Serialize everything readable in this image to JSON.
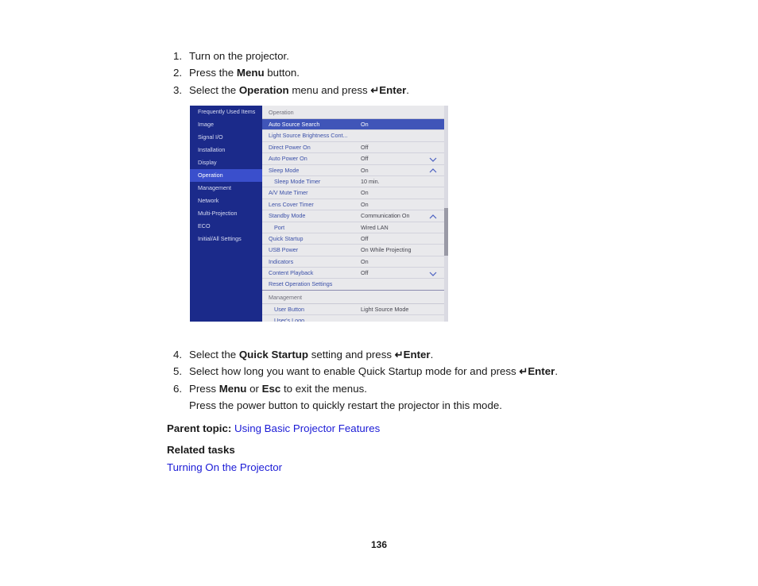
{
  "document": {
    "page_number": "136"
  },
  "steps": [
    {
      "num": "1.",
      "pre": "Turn on the projector.",
      "bold": "",
      "post": "",
      "enter": false,
      "tail": ""
    },
    {
      "num": "2.",
      "pre": "Press the ",
      "bold": "Menu",
      "post": " button.",
      "enter": false,
      "tail": ""
    },
    {
      "num": "3.",
      "pre": "Select the ",
      "bold": "Operation",
      "post": " menu and press ",
      "enter": true,
      "enter_label": "Enter",
      "tail": "."
    },
    {
      "num": "4.",
      "pre": "Select the ",
      "bold": "Quick Startup",
      "post": " setting and press ",
      "enter": true,
      "enter_label": "Enter",
      "tail": "."
    },
    {
      "num": "5.",
      "pre": "Select how long you want to enable Quick Startup mode for and press ",
      "bold": "",
      "post": "",
      "enter": true,
      "enter_label": "Enter",
      "tail": "."
    },
    {
      "num": "6.",
      "pre": "Press ",
      "bold": "Menu",
      "post": " or ",
      "bold2": "Esc",
      "post2": " to exit the menus.",
      "enter": false,
      "tail": ""
    }
  ],
  "step_labels": {
    "s1_num": "1.",
    "s1_text": "Turn on the projector.",
    "s2_num": "2.",
    "s2_pre": "Press the ",
    "s2_bold": "Menu",
    "s2_post": " button.",
    "s3_num": "3.",
    "s3_pre": "Select the ",
    "s3_bold": "Operation",
    "s3_mid": " menu and press ",
    "s3_enter": "Enter",
    "s3_tail": ".",
    "s4_num": "4.",
    "s4_pre": "Select the ",
    "s4_bold": "Quick Startup",
    "s4_mid": " setting and press ",
    "s4_enter": "Enter",
    "s4_tail": ".",
    "s5_num": "5.",
    "s5_pre": "Select how long you want to enable Quick Startup mode for and press ",
    "s5_enter": "Enter",
    "s5_tail": ".",
    "s6_num": "6.",
    "s6_pre": "Press ",
    "s6_bold": "Menu",
    "s6_mid": " or ",
    "s6_bold2": "Esc",
    "s6_tail": " to exit the menus.",
    "enter_glyph": "↵"
  },
  "note": "Press the power button to quickly restart the projector in this mode.",
  "parent_topic": {
    "label": "Parent topic:",
    "link_text": "Using Basic Projector Features"
  },
  "related": {
    "heading": "Related tasks",
    "links": [
      "Turning On the Projector"
    ],
    "link_1": "Turning On the Projector"
  },
  "osd": {
    "sidebar": {
      "items": [
        {
          "label": "Frequently Used Items",
          "selected": false
        },
        {
          "label": "Image",
          "selected": false
        },
        {
          "label": "Signal I/O",
          "selected": false
        },
        {
          "label": "Installation",
          "selected": false
        },
        {
          "label": "Display",
          "selected": false
        },
        {
          "label": "Operation",
          "selected": true
        },
        {
          "label": "Management",
          "selected": false
        },
        {
          "label": "Network",
          "selected": false
        },
        {
          "label": "Multi-Projection",
          "selected": false
        },
        {
          "label": "ECO",
          "selected": false
        },
        {
          "label": "Initial/All Settings",
          "selected": false
        }
      ]
    },
    "group_title": "Operation",
    "rows": [
      {
        "label": "Auto Source Search",
        "value": "On",
        "chevron": "",
        "indent": false,
        "highlight": true
      },
      {
        "label": "Light Source Brightness Cont...",
        "value": "",
        "chevron": "",
        "indent": false,
        "highlight": false
      },
      {
        "label": "Direct Power On",
        "value": "Off",
        "chevron": "",
        "indent": false,
        "highlight": false
      },
      {
        "label": "Auto Power On",
        "value": "Off",
        "chevron": "down",
        "indent": false,
        "highlight": false
      },
      {
        "label": "Sleep Mode",
        "value": "On",
        "chevron": "up",
        "indent": false,
        "highlight": false
      },
      {
        "label": "Sleep Mode Timer",
        "value": "10 min.",
        "chevron": "",
        "indent": true,
        "highlight": false
      },
      {
        "label": "A/V Mute Timer",
        "value": "On",
        "chevron": "",
        "indent": false,
        "highlight": false
      },
      {
        "label": "Lens Cover Timer",
        "value": "On",
        "chevron": "",
        "indent": false,
        "highlight": false
      },
      {
        "label": "Standby Mode",
        "value": "Communication On",
        "chevron": "up",
        "indent": false,
        "highlight": false
      },
      {
        "label": "Port",
        "value": "Wired LAN",
        "chevron": "",
        "indent": true,
        "highlight": false
      },
      {
        "label": "Quick Startup",
        "value": "Off",
        "chevron": "",
        "indent": false,
        "highlight": false
      },
      {
        "label": "USB Power",
        "value": "On While Projecting",
        "chevron": "",
        "indent": false,
        "highlight": false
      },
      {
        "label": "Indicators",
        "value": "On",
        "chevron": "",
        "indent": false,
        "highlight": false
      },
      {
        "label": "Content Playback",
        "value": "Off",
        "chevron": "down",
        "indent": false,
        "highlight": false
      },
      {
        "label": "Reset Operation Settings",
        "value": "",
        "chevron": "",
        "indent": false,
        "highlight": false
      }
    ],
    "group_title_2": "Management",
    "rows_2": [
      {
        "label": "User Button",
        "value": "Light Source Mode",
        "chevron": "",
        "indent": true,
        "highlight": false
      },
      {
        "label": "User's Logo",
        "value": "",
        "chevron": "",
        "indent": true,
        "highlight": false
      }
    ],
    "colors": {
      "sidebar_bg": "#1b2a8a",
      "sidebar_selected": "#3a4fcc",
      "row_highlight": "#4055b8",
      "panel_bg": "#e9e9ec",
      "label_text": "#3b50a8",
      "value_text": "#45454f",
      "scrollbar_thumb": "#9a9aa6"
    }
  }
}
